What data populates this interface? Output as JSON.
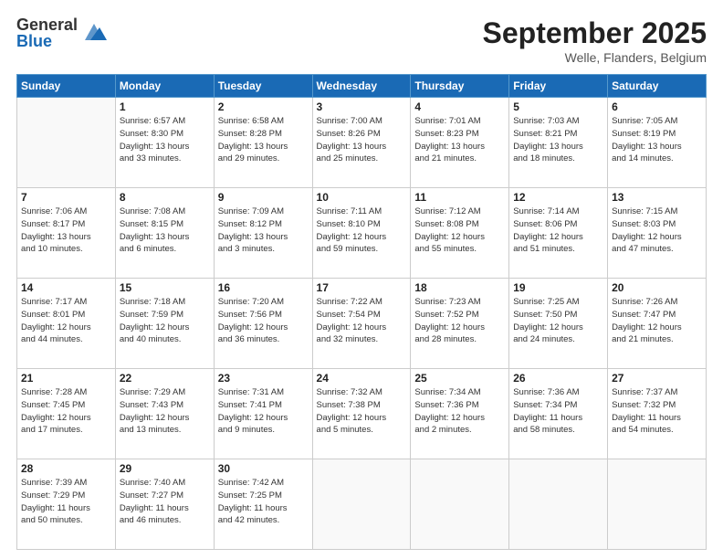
{
  "logo": {
    "general": "General",
    "blue": "Blue"
  },
  "title": "September 2025",
  "location": "Welle, Flanders, Belgium",
  "days_of_week": [
    "Sunday",
    "Monday",
    "Tuesday",
    "Wednesday",
    "Thursday",
    "Friday",
    "Saturday"
  ],
  "weeks": [
    [
      {
        "day": "",
        "info": ""
      },
      {
        "day": "1",
        "info": "Sunrise: 6:57 AM\nSunset: 8:30 PM\nDaylight: 13 hours\nand 33 minutes."
      },
      {
        "day": "2",
        "info": "Sunrise: 6:58 AM\nSunset: 8:28 PM\nDaylight: 13 hours\nand 29 minutes."
      },
      {
        "day": "3",
        "info": "Sunrise: 7:00 AM\nSunset: 8:26 PM\nDaylight: 13 hours\nand 25 minutes."
      },
      {
        "day": "4",
        "info": "Sunrise: 7:01 AM\nSunset: 8:23 PM\nDaylight: 13 hours\nand 21 minutes."
      },
      {
        "day": "5",
        "info": "Sunrise: 7:03 AM\nSunset: 8:21 PM\nDaylight: 13 hours\nand 18 minutes."
      },
      {
        "day": "6",
        "info": "Sunrise: 7:05 AM\nSunset: 8:19 PM\nDaylight: 13 hours\nand 14 minutes."
      }
    ],
    [
      {
        "day": "7",
        "info": "Sunrise: 7:06 AM\nSunset: 8:17 PM\nDaylight: 13 hours\nand 10 minutes."
      },
      {
        "day": "8",
        "info": "Sunrise: 7:08 AM\nSunset: 8:15 PM\nDaylight: 13 hours\nand 6 minutes."
      },
      {
        "day": "9",
        "info": "Sunrise: 7:09 AM\nSunset: 8:12 PM\nDaylight: 13 hours\nand 3 minutes."
      },
      {
        "day": "10",
        "info": "Sunrise: 7:11 AM\nSunset: 8:10 PM\nDaylight: 12 hours\nand 59 minutes."
      },
      {
        "day": "11",
        "info": "Sunrise: 7:12 AM\nSunset: 8:08 PM\nDaylight: 12 hours\nand 55 minutes."
      },
      {
        "day": "12",
        "info": "Sunrise: 7:14 AM\nSunset: 8:06 PM\nDaylight: 12 hours\nand 51 minutes."
      },
      {
        "day": "13",
        "info": "Sunrise: 7:15 AM\nSunset: 8:03 PM\nDaylight: 12 hours\nand 47 minutes."
      }
    ],
    [
      {
        "day": "14",
        "info": "Sunrise: 7:17 AM\nSunset: 8:01 PM\nDaylight: 12 hours\nand 44 minutes."
      },
      {
        "day": "15",
        "info": "Sunrise: 7:18 AM\nSunset: 7:59 PM\nDaylight: 12 hours\nand 40 minutes."
      },
      {
        "day": "16",
        "info": "Sunrise: 7:20 AM\nSunset: 7:56 PM\nDaylight: 12 hours\nand 36 minutes."
      },
      {
        "day": "17",
        "info": "Sunrise: 7:22 AM\nSunset: 7:54 PM\nDaylight: 12 hours\nand 32 minutes."
      },
      {
        "day": "18",
        "info": "Sunrise: 7:23 AM\nSunset: 7:52 PM\nDaylight: 12 hours\nand 28 minutes."
      },
      {
        "day": "19",
        "info": "Sunrise: 7:25 AM\nSunset: 7:50 PM\nDaylight: 12 hours\nand 24 minutes."
      },
      {
        "day": "20",
        "info": "Sunrise: 7:26 AM\nSunset: 7:47 PM\nDaylight: 12 hours\nand 21 minutes."
      }
    ],
    [
      {
        "day": "21",
        "info": "Sunrise: 7:28 AM\nSunset: 7:45 PM\nDaylight: 12 hours\nand 17 minutes."
      },
      {
        "day": "22",
        "info": "Sunrise: 7:29 AM\nSunset: 7:43 PM\nDaylight: 12 hours\nand 13 minutes."
      },
      {
        "day": "23",
        "info": "Sunrise: 7:31 AM\nSunset: 7:41 PM\nDaylight: 12 hours\nand 9 minutes."
      },
      {
        "day": "24",
        "info": "Sunrise: 7:32 AM\nSunset: 7:38 PM\nDaylight: 12 hours\nand 5 minutes."
      },
      {
        "day": "25",
        "info": "Sunrise: 7:34 AM\nSunset: 7:36 PM\nDaylight: 12 hours\nand 2 minutes."
      },
      {
        "day": "26",
        "info": "Sunrise: 7:36 AM\nSunset: 7:34 PM\nDaylight: 11 hours\nand 58 minutes."
      },
      {
        "day": "27",
        "info": "Sunrise: 7:37 AM\nSunset: 7:32 PM\nDaylight: 11 hours\nand 54 minutes."
      }
    ],
    [
      {
        "day": "28",
        "info": "Sunrise: 7:39 AM\nSunset: 7:29 PM\nDaylight: 11 hours\nand 50 minutes."
      },
      {
        "day": "29",
        "info": "Sunrise: 7:40 AM\nSunset: 7:27 PM\nDaylight: 11 hours\nand 46 minutes."
      },
      {
        "day": "30",
        "info": "Sunrise: 7:42 AM\nSunset: 7:25 PM\nDaylight: 11 hours\nand 42 minutes."
      },
      {
        "day": "",
        "info": ""
      },
      {
        "day": "",
        "info": ""
      },
      {
        "day": "",
        "info": ""
      },
      {
        "day": "",
        "info": ""
      }
    ]
  ]
}
